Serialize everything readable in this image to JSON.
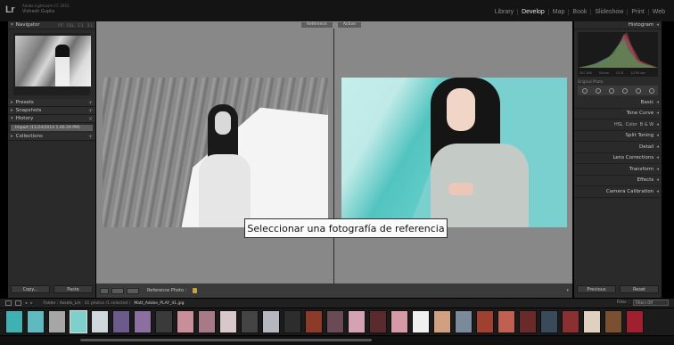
{
  "app": {
    "logo": "Lr",
    "version": "Adobe Lightroom CC 2015",
    "user": "Vishesh Gupta"
  },
  "modules": [
    "Library",
    "Develop",
    "Map",
    "Book",
    "Slideshow",
    "Print",
    "Web"
  ],
  "active_module": "Develop",
  "left_panel": {
    "navigator": {
      "title": "Navigator",
      "zoom": [
        "FIT",
        "FILL",
        "1:1",
        "3:1"
      ]
    },
    "presets": "Presets",
    "snapshots": "Snapshots",
    "history": {
      "title": "History",
      "items": [
        "Import (11/24/2014 1:46:29 PM)"
      ]
    },
    "collections": "Collections",
    "copy_label": "Copy...",
    "paste_label": "Paste"
  },
  "center": {
    "reference_tag": "Reference",
    "active_tag": "Active",
    "tooltip": "Seleccionar una fotografía de referencia"
  },
  "toolbar": {
    "label": "Reference Photo :"
  },
  "right_panel": {
    "histogram": {
      "title": "Histogram",
      "stats": [
        "ISO 160",
        "51mm",
        "f/2.8",
        "1/250 sec"
      ],
      "original_photo": "Original Photo"
    },
    "sections": [
      "Basic",
      "Tone Curve"
    ],
    "hsl": [
      "HSL",
      "Color",
      "B & W"
    ],
    "sections2": [
      "Split Toning",
      "Detail",
      "Lens Corrections",
      "Transform",
      "Effects",
      "Camera Calibration"
    ],
    "previous_label": "Previous",
    "reset_label": "Reset"
  },
  "filmbar": {
    "source": "Folder : Assets_Lrk",
    "count": "41 photos /1 selected /",
    "file": "Matt_Adobe_PLAY_41.jpg",
    "filter_label": "Filter :",
    "filter_value": "Filters Off"
  },
  "filmstrip": {
    "thumb_colors": [
      "#3fb1b4",
      "#5fb9c0",
      "#a6a6a6",
      "#7fd0cd",
      "#cfd6dc",
      "#6b5a8a",
      "#8a6fa0",
      "#3a3a3a",
      "#c88e9a",
      "#a87a88",
      "#d8c8c8",
      "#444",
      "#b7b7c0",
      "#2d2d2d",
      "#8c3b2a",
      "#6a4a55",
      "#d4a2b2",
      "#5a2a2e",
      "#d69aa7",
      "#f0f0f0",
      "#d0a080",
      "#7a8a9a",
      "#a04030",
      "#c06050",
      "#6a2a2a",
      "#3a4a5a",
      "#8a3030",
      "#e0d0c0",
      "#7a5030",
      "#a02030"
    ],
    "selected_index": 3
  }
}
